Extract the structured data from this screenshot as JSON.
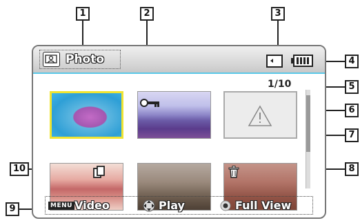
{
  "callouts": {
    "c1": "1",
    "c2": "2",
    "c3": "3",
    "c4": "4",
    "c5": "5",
    "c6": "6",
    "c7": "7",
    "c8": "8",
    "c9": "9",
    "c10": "10"
  },
  "header": {
    "mode_label": "Photo"
  },
  "status": {
    "page_counter": "1/10"
  },
  "bottom_bar": {
    "menu_label": "MENU",
    "video_label": "Video",
    "play_label": "Play",
    "full_view_label": "Full View"
  },
  "colors": {
    "accent": "#58c8e8",
    "selection": "#f0e431"
  },
  "icons": [
    "photo-mode-icon",
    "memory-card-icon",
    "battery-icon",
    "protect-key-icon",
    "copy-icon",
    "delete-icon",
    "warning-icon",
    "dpad-icon",
    "ok-button-icon"
  ],
  "scrollbar_position": 0.1
}
